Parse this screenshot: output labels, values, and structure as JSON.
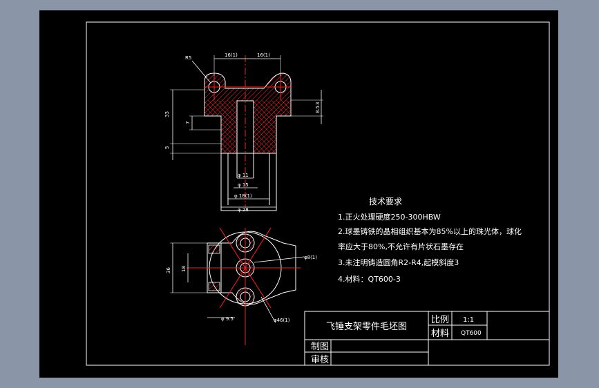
{
  "technical_requirements": {
    "title": "技术要求",
    "items": [
      "1.正火处理硬度250-300HBW",
      "2.球墨铸铁的晶相组织基本为85%以上的珠光体，球化",
      "率应大于80%,不允许有片状石墨存在",
      "3.未注明铸造圆角R2-R4,起模斜度3",
      "4.材料：QT600-3"
    ]
  },
  "title_block": {
    "drawing_name": "飞锤支架零件毛坯图",
    "scale_label": "比例",
    "scale_value": "1:1",
    "material_label": "材料",
    "material_value": "QT600",
    "drawn_label": "制图",
    "checked_label": "审核"
  },
  "dimensions": {
    "top_left_width": "16(1)",
    "top_right_width": "16(1)",
    "hole_callout": "R5",
    "dia_11": "φ 11",
    "dia_15": "φ 15",
    "dia_18": "φ 18(1)",
    "dia_28": "φ 28",
    "height_left": "33",
    "height_step": "7",
    "height_bottom": "5",
    "height_right_a": "3",
    "height_right_b": "8.5",
    "plan_height_outer": "36",
    "plan_height_inner": "18",
    "plan_dia_center": "φ8(1)",
    "plan_dia_pcd": "φ46(1)",
    "plan_dia_small": "φ 9.5"
  },
  "colors": {
    "background": "#8a96a8",
    "frame": "#000000",
    "line": "#ffffff",
    "hatch": "#ff3030",
    "centerline": "#ff2020",
    "text": "#ffffff"
  }
}
